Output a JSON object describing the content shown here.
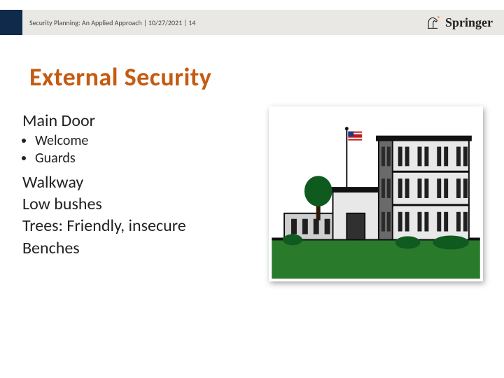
{
  "header": {
    "breadcrumb": "Security Planning: An Applied Approach | 10/27/2021 | 14",
    "brand_name": "Springer"
  },
  "title": "External Security",
  "body": {
    "subhead": "Main Door",
    "bullets": [
      "Welcome",
      "Guards"
    ],
    "lines": [
      "Walkway",
      "Low bushes",
      "Trees: Friendly, insecure",
      "Benches"
    ]
  },
  "illustration": {
    "alt": "office-building-with-flag",
    "colors": {
      "sky": "#ffffff",
      "grass": "#2a7a2c",
      "building_light": "#e8e8e8",
      "building_mid": "#cfcfcf",
      "building_dark": "#6a6a6a",
      "outline": "#111111",
      "flag_red": "#c31b1b",
      "flag_blue": "#1b3a8a",
      "tree": "#0e5a1f",
      "door": "#303030",
      "window": "#1f1f1f"
    }
  }
}
